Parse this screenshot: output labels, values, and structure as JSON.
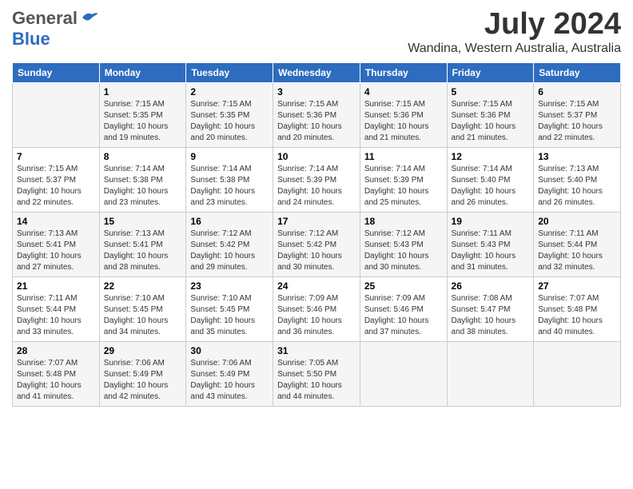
{
  "header": {
    "logo_general": "General",
    "logo_blue": "Blue",
    "title": "July 2024",
    "subtitle": "Wandina, Western Australia, Australia"
  },
  "days": [
    "Sunday",
    "Monday",
    "Tuesday",
    "Wednesday",
    "Thursday",
    "Friday",
    "Saturday"
  ],
  "weeks": [
    [
      {
        "date": "",
        "sunrise": "",
        "sunset": "",
        "daylight": ""
      },
      {
        "date": "1",
        "sunrise": "Sunrise: 7:15 AM",
        "sunset": "Sunset: 5:35 PM",
        "daylight": "Daylight: 10 hours and 19 minutes."
      },
      {
        "date": "2",
        "sunrise": "Sunrise: 7:15 AM",
        "sunset": "Sunset: 5:35 PM",
        "daylight": "Daylight: 10 hours and 20 minutes."
      },
      {
        "date": "3",
        "sunrise": "Sunrise: 7:15 AM",
        "sunset": "Sunset: 5:36 PM",
        "daylight": "Daylight: 10 hours and 20 minutes."
      },
      {
        "date": "4",
        "sunrise": "Sunrise: 7:15 AM",
        "sunset": "Sunset: 5:36 PM",
        "daylight": "Daylight: 10 hours and 21 minutes."
      },
      {
        "date": "5",
        "sunrise": "Sunrise: 7:15 AM",
        "sunset": "Sunset: 5:36 PM",
        "daylight": "Daylight: 10 hours and 21 minutes."
      },
      {
        "date": "6",
        "sunrise": "Sunrise: 7:15 AM",
        "sunset": "Sunset: 5:37 PM",
        "daylight": "Daylight: 10 hours and 22 minutes."
      }
    ],
    [
      {
        "date": "7",
        "sunrise": "Sunrise: 7:15 AM",
        "sunset": "Sunset: 5:37 PM",
        "daylight": "Daylight: 10 hours and 22 minutes."
      },
      {
        "date": "8",
        "sunrise": "Sunrise: 7:14 AM",
        "sunset": "Sunset: 5:38 PM",
        "daylight": "Daylight: 10 hours and 23 minutes."
      },
      {
        "date": "9",
        "sunrise": "Sunrise: 7:14 AM",
        "sunset": "Sunset: 5:38 PM",
        "daylight": "Daylight: 10 hours and 23 minutes."
      },
      {
        "date": "10",
        "sunrise": "Sunrise: 7:14 AM",
        "sunset": "Sunset: 5:39 PM",
        "daylight": "Daylight: 10 hours and 24 minutes."
      },
      {
        "date": "11",
        "sunrise": "Sunrise: 7:14 AM",
        "sunset": "Sunset: 5:39 PM",
        "daylight": "Daylight: 10 hours and 25 minutes."
      },
      {
        "date": "12",
        "sunrise": "Sunrise: 7:14 AM",
        "sunset": "Sunset: 5:40 PM",
        "daylight": "Daylight: 10 hours and 26 minutes."
      },
      {
        "date": "13",
        "sunrise": "Sunrise: 7:13 AM",
        "sunset": "Sunset: 5:40 PM",
        "daylight": "Daylight: 10 hours and 26 minutes."
      }
    ],
    [
      {
        "date": "14",
        "sunrise": "Sunrise: 7:13 AM",
        "sunset": "Sunset: 5:41 PM",
        "daylight": "Daylight: 10 hours and 27 minutes."
      },
      {
        "date": "15",
        "sunrise": "Sunrise: 7:13 AM",
        "sunset": "Sunset: 5:41 PM",
        "daylight": "Daylight: 10 hours and 28 minutes."
      },
      {
        "date": "16",
        "sunrise": "Sunrise: 7:12 AM",
        "sunset": "Sunset: 5:42 PM",
        "daylight": "Daylight: 10 hours and 29 minutes."
      },
      {
        "date": "17",
        "sunrise": "Sunrise: 7:12 AM",
        "sunset": "Sunset: 5:42 PM",
        "daylight": "Daylight: 10 hours and 30 minutes."
      },
      {
        "date": "18",
        "sunrise": "Sunrise: 7:12 AM",
        "sunset": "Sunset: 5:43 PM",
        "daylight": "Daylight: 10 hours and 30 minutes."
      },
      {
        "date": "19",
        "sunrise": "Sunrise: 7:11 AM",
        "sunset": "Sunset: 5:43 PM",
        "daylight": "Daylight: 10 hours and 31 minutes."
      },
      {
        "date": "20",
        "sunrise": "Sunrise: 7:11 AM",
        "sunset": "Sunset: 5:44 PM",
        "daylight": "Daylight: 10 hours and 32 minutes."
      }
    ],
    [
      {
        "date": "21",
        "sunrise": "Sunrise: 7:11 AM",
        "sunset": "Sunset: 5:44 PM",
        "daylight": "Daylight: 10 hours and 33 minutes."
      },
      {
        "date": "22",
        "sunrise": "Sunrise: 7:10 AM",
        "sunset": "Sunset: 5:45 PM",
        "daylight": "Daylight: 10 hours and 34 minutes."
      },
      {
        "date": "23",
        "sunrise": "Sunrise: 7:10 AM",
        "sunset": "Sunset: 5:45 PM",
        "daylight": "Daylight: 10 hours and 35 minutes."
      },
      {
        "date": "24",
        "sunrise": "Sunrise: 7:09 AM",
        "sunset": "Sunset: 5:46 PM",
        "daylight": "Daylight: 10 hours and 36 minutes."
      },
      {
        "date": "25",
        "sunrise": "Sunrise: 7:09 AM",
        "sunset": "Sunset: 5:46 PM",
        "daylight": "Daylight: 10 hours and 37 minutes."
      },
      {
        "date": "26",
        "sunrise": "Sunrise: 7:08 AM",
        "sunset": "Sunset: 5:47 PM",
        "daylight": "Daylight: 10 hours and 38 minutes."
      },
      {
        "date": "27",
        "sunrise": "Sunrise: 7:07 AM",
        "sunset": "Sunset: 5:48 PM",
        "daylight": "Daylight: 10 hours and 40 minutes."
      }
    ],
    [
      {
        "date": "28",
        "sunrise": "Sunrise: 7:07 AM",
        "sunset": "Sunset: 5:48 PM",
        "daylight": "Daylight: 10 hours and 41 minutes."
      },
      {
        "date": "29",
        "sunrise": "Sunrise: 7:06 AM",
        "sunset": "Sunset: 5:49 PM",
        "daylight": "Daylight: 10 hours and 42 minutes."
      },
      {
        "date": "30",
        "sunrise": "Sunrise: 7:06 AM",
        "sunset": "Sunset: 5:49 PM",
        "daylight": "Daylight: 10 hours and 43 minutes."
      },
      {
        "date": "31",
        "sunrise": "Sunrise: 7:05 AM",
        "sunset": "Sunset: 5:50 PM",
        "daylight": "Daylight: 10 hours and 44 minutes."
      },
      {
        "date": "",
        "sunrise": "",
        "sunset": "",
        "daylight": ""
      },
      {
        "date": "",
        "sunrise": "",
        "sunset": "",
        "daylight": ""
      },
      {
        "date": "",
        "sunrise": "",
        "sunset": "",
        "daylight": ""
      }
    ]
  ]
}
